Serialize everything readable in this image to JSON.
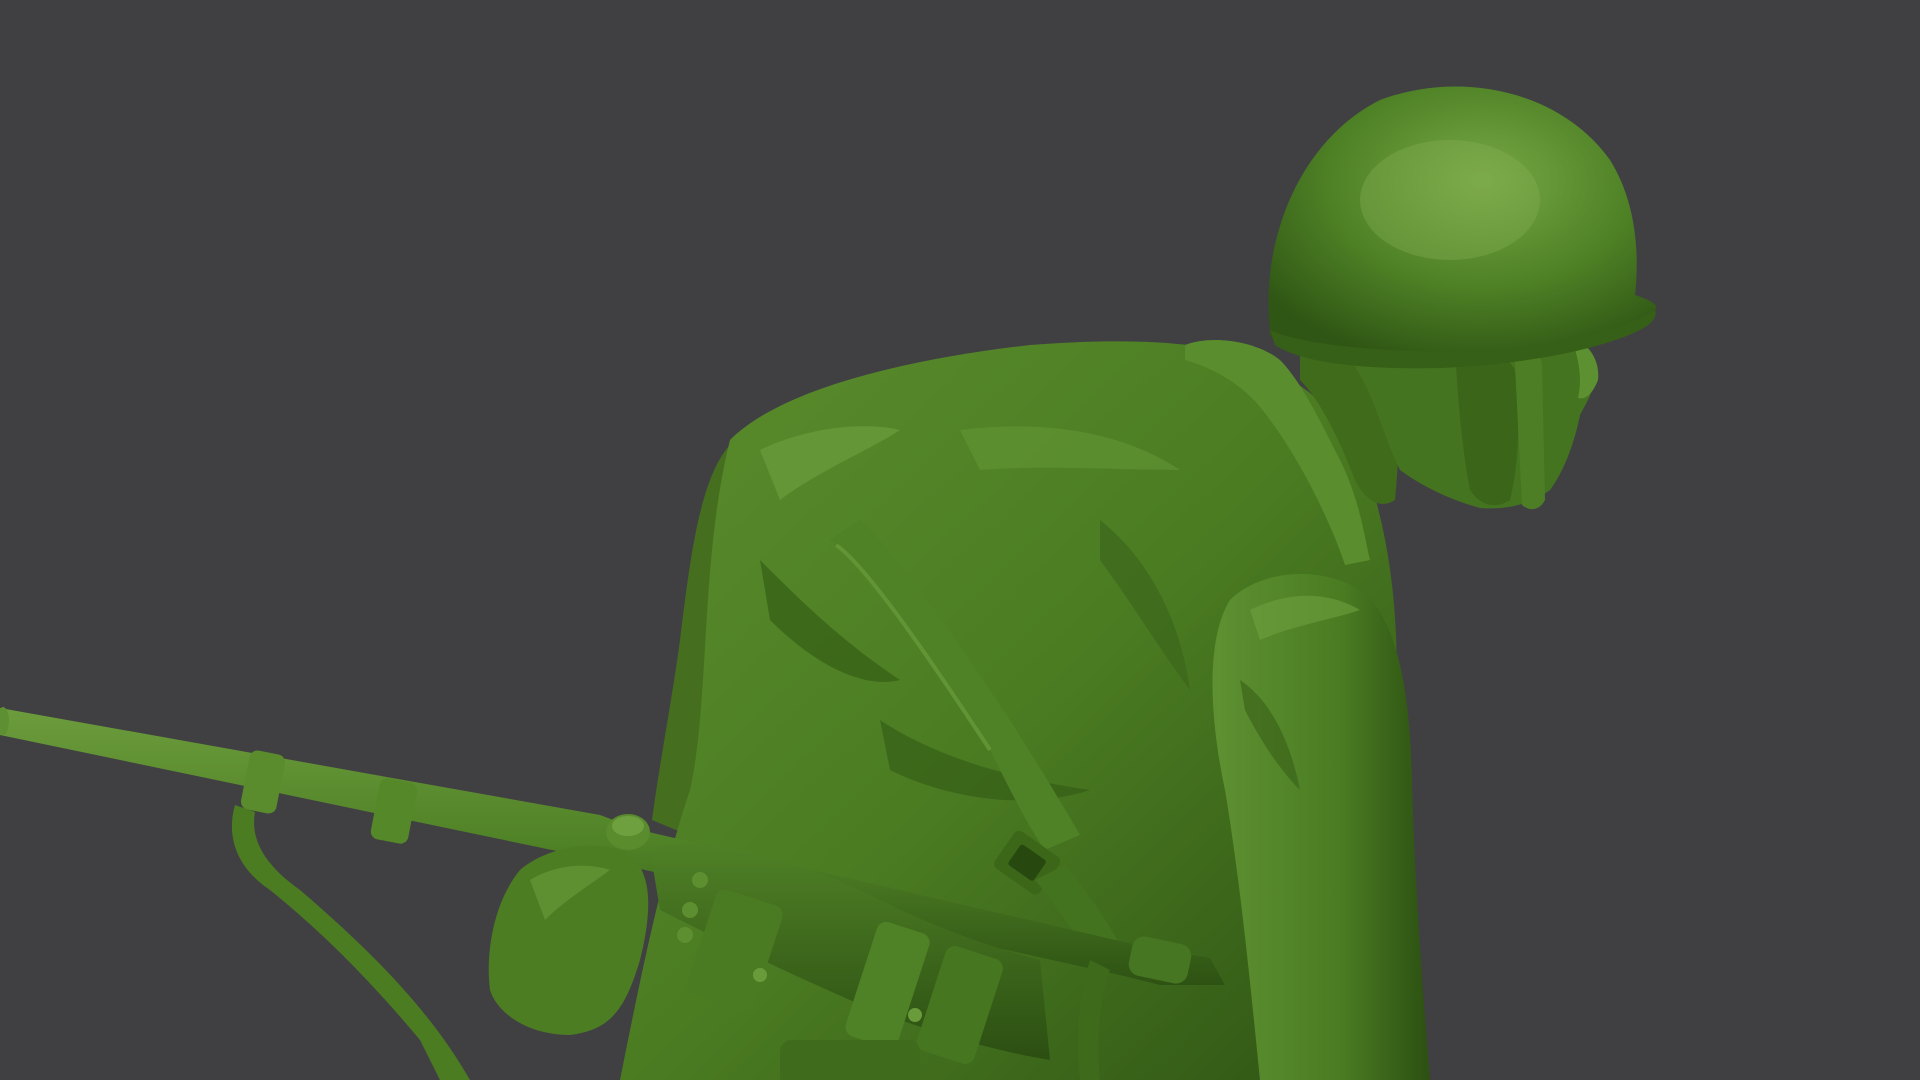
{
  "scene": {
    "subject": "green-plastic-toy-soldier-sculpt",
    "colors": {
      "background": "#404042",
      "figure_base": "#4e7f24",
      "figure_light": "#6a9a3a",
      "figure_dark": "#2f5412",
      "figure_deep_shadow": "#223f0c"
    }
  }
}
